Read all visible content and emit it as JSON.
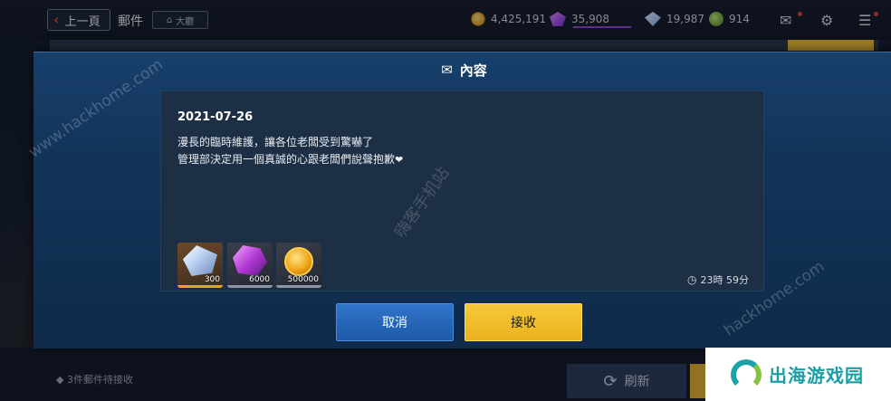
{
  "topbar": {
    "back_label": "上一頁",
    "title": "郵件",
    "lobby_label": "大廳",
    "gold": "4,425,191",
    "crystal": "35,908",
    "diamond": "19,987",
    "leaf": "914"
  },
  "background": {
    "pending_text": "3件郵件待接收",
    "refresh_label": "刷新"
  },
  "modal": {
    "title": "內容",
    "date": "2021-07-26",
    "line1": "漫長的臨時維護，讓各位老闆受到驚嚇了",
    "line2": "管理部決定用一個真誠的心跟老闆們說聲抱歉",
    "rewards": [
      {
        "type": "diamond",
        "amount": "300"
      },
      {
        "type": "crystal",
        "amount": "6000"
      },
      {
        "type": "gold-coin",
        "amount": "500000"
      }
    ],
    "timer": "23時 59分",
    "cancel_label": "取消",
    "receive_label": "接收"
  },
  "watermarks": {
    "site": "www.hackhome.com",
    "site2": "hackhome.com",
    "cn": "嗨客手机站",
    "brand": "出海游戏园"
  },
  "colors": {
    "modal_blue": "#17406d",
    "cancel_blue": "#2f74c9",
    "receive_yellow": "#f7c93a",
    "alert_red": "#e53935"
  }
}
